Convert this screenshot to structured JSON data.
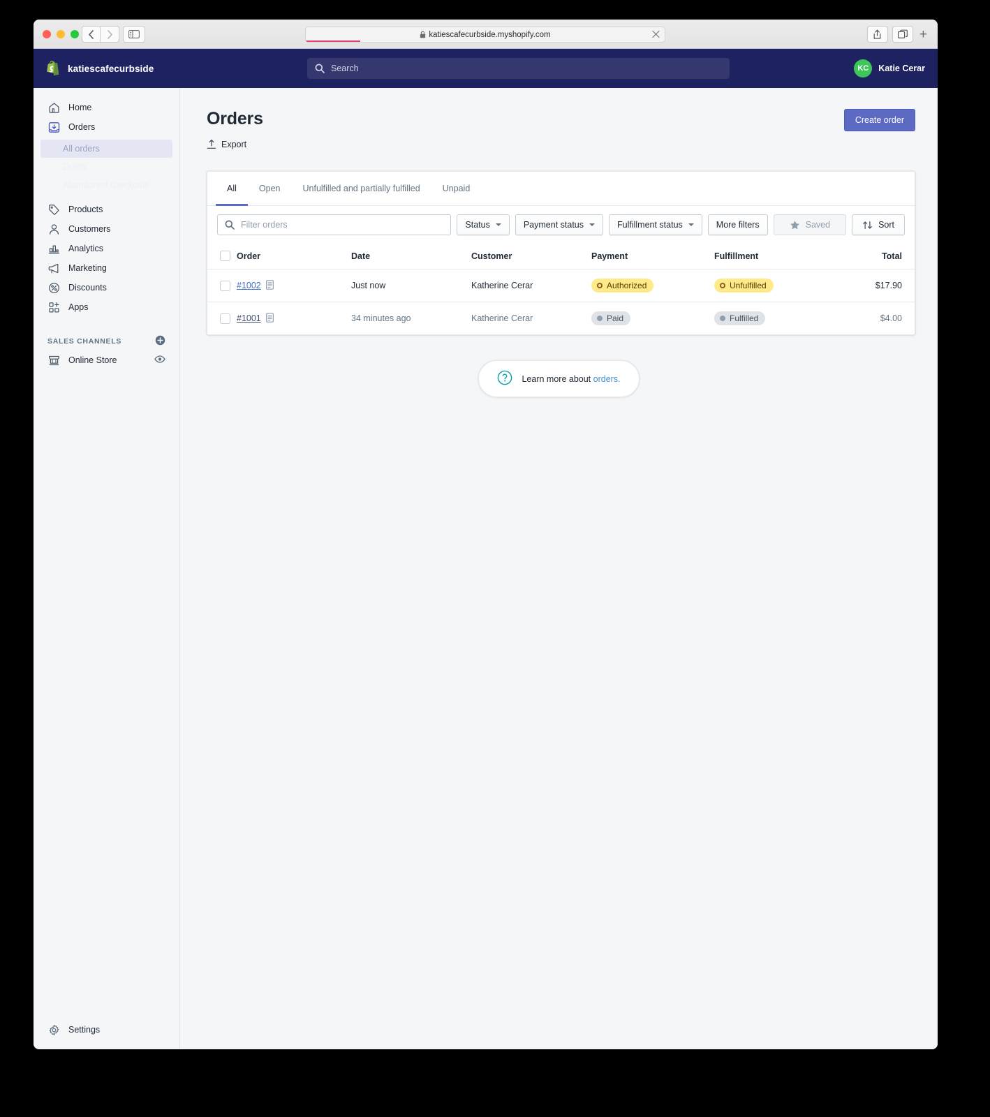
{
  "browser": {
    "url": "katiescafecurbside.myshopify.com",
    "back_icon": "chevron-left-icon",
    "forward_icon": "chevron-right-icon",
    "sidebar_toggle_icon": "sidebar-toggle-icon",
    "lock_icon": "lock-icon",
    "stop_icon": "close-icon",
    "share_icon": "share-icon",
    "tabs_icon": "tab-overview-icon",
    "new_tab_label": "+",
    "loading_accent": "#ea3d73"
  },
  "topbar": {
    "logo_icon": "shopify-logo-icon",
    "store_name": "katiescafecurbside",
    "search_placeholder": "Search",
    "search_icon": "search-icon",
    "account_initials": "KC",
    "account_name": "Katie Cerar",
    "avatar_color": "#3ec65b",
    "background": "#1f2260"
  },
  "sidebar": {
    "items": [
      {
        "label": "Home",
        "icon": "home-icon"
      },
      {
        "label": "Orders",
        "icon": "orders-inbox-icon"
      }
    ],
    "orders_subitems": [
      {
        "label": "All orders",
        "state": "active"
      },
      {
        "label": "Drafts",
        "state": "fading"
      },
      {
        "label": "Abandoned checkouts",
        "state": "fading"
      }
    ],
    "items2": [
      {
        "label": "Products",
        "icon": "tag-icon"
      },
      {
        "label": "Customers",
        "icon": "person-icon"
      },
      {
        "label": "Analytics",
        "icon": "bar-chart-icon"
      },
      {
        "label": "Marketing",
        "icon": "megaphone-icon"
      },
      {
        "label": "Discounts",
        "icon": "percent-circle-icon"
      },
      {
        "label": "Apps",
        "icon": "apps-grid-plus-icon"
      }
    ],
    "sales_channels_header": "SALES CHANNELS",
    "sales_channels_add_icon": "plus-circle-icon",
    "sales_channels": [
      {
        "label": "Online Store",
        "icon": "storefront-icon",
        "trailing_icon": "eye-icon"
      }
    ],
    "settings": {
      "label": "Settings",
      "icon": "gear-icon"
    }
  },
  "page": {
    "title": "Orders",
    "export_label": "Export",
    "export_icon": "upload-icon",
    "create_order_label": "Create order",
    "create_order_color": "#5c6ac4"
  },
  "tabs": [
    {
      "label": "All",
      "active": true
    },
    {
      "label": "Open",
      "active": false
    },
    {
      "label": "Unfulfilled and partially fulfilled",
      "active": false
    },
    {
      "label": "Unpaid",
      "active": false
    }
  ],
  "filters": {
    "search_placeholder": "Filter orders",
    "search_icon": "search-icon",
    "buttons": [
      {
        "label": "Status",
        "has_caret": true,
        "disabled": false
      },
      {
        "label": "Payment status",
        "has_caret": true,
        "disabled": false
      },
      {
        "label": "Fulfillment status",
        "has_caret": true,
        "disabled": false
      },
      {
        "label": "More filters",
        "has_caret": false,
        "disabled": false
      }
    ],
    "saved_label": "Saved",
    "saved_icon": "star-icon",
    "saved_disabled": true,
    "sort_label": "Sort",
    "sort_icon": "sort-arrows-icon"
  },
  "table": {
    "columns": [
      "Order",
      "Date",
      "Customer",
      "Payment",
      "Fulfillment",
      "Total"
    ],
    "rows": [
      {
        "order": "#1002",
        "note_icon": "note-document-icon",
        "date": "Just now",
        "customer": "Katherine Cerar",
        "payment": "Authorized",
        "payment_style": "warn",
        "fulfillment": "Unfulfilled",
        "fulfillment_style": "warn",
        "total": "$17.90",
        "total_muted": false
      },
      {
        "order": "#1001",
        "note_icon": "note-document-icon",
        "date": "34 minutes ago",
        "customer": "Katherine Cerar",
        "payment": "Paid",
        "payment_style": "neutral",
        "fulfillment": "Fulfilled",
        "fulfillment_style": "neutral",
        "total": "$4.00",
        "total_muted": true
      }
    ]
  },
  "help": {
    "icon": "question-circle-icon",
    "text": "Learn more about ",
    "link": "orders.",
    "icon_color": "#00a0ac"
  }
}
